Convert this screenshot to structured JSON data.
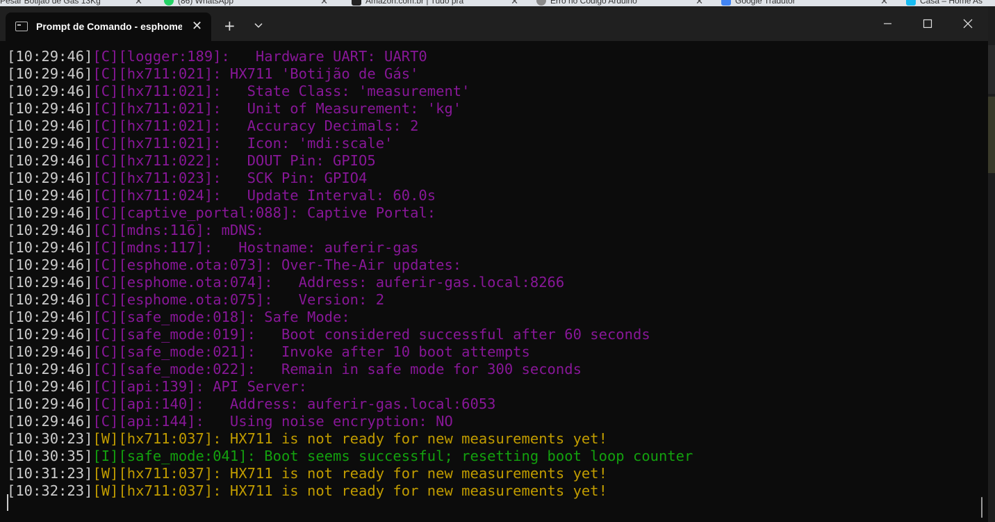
{
  "background_tabs": [
    {
      "label": "Pesar Botijão de Gás 13Kg",
      "favicon_color": "#cfd4da"
    },
    {
      "label": "(86) WhatsApp",
      "favicon_color": "#25d366"
    },
    {
      "label": "Amazon.com.br | Tudo pra",
      "favicon_color": "#222222"
    },
    {
      "label": "Erro no Código Arduino",
      "favicon_color": "#8a8a8a"
    },
    {
      "label": "Google Tradutor",
      "favicon_color": "#4285f4"
    },
    {
      "label": "Casa – Home As",
      "favicon_color": "#18bcf2"
    }
  ],
  "window": {
    "tab_title": "Prompt de Comando - esphome",
    "new_tab": "+",
    "close_glyph": "✕"
  },
  "colors": {
    "config": "#881798",
    "warning": "#c19c00",
    "info": "#13a10e",
    "timestamp": "#cccccc"
  },
  "log_lines": [
    {
      "ts": "[10:29:46]",
      "level": "c",
      "text": "[C][logger:189]:   Hardware UART: UART0"
    },
    {
      "ts": "[10:29:46]",
      "level": "c",
      "text": "[C][hx711:021]: HX711 'Botijão de Gás'"
    },
    {
      "ts": "[10:29:46]",
      "level": "c",
      "text": "[C][hx711:021]:   State Class: 'measurement'"
    },
    {
      "ts": "[10:29:46]",
      "level": "c",
      "text": "[C][hx711:021]:   Unit of Measurement: 'kg'"
    },
    {
      "ts": "[10:29:46]",
      "level": "c",
      "text": "[C][hx711:021]:   Accuracy Decimals: 2"
    },
    {
      "ts": "[10:29:46]",
      "level": "c",
      "text": "[C][hx711:021]:   Icon: 'mdi:scale'"
    },
    {
      "ts": "[10:29:46]",
      "level": "c",
      "text": "[C][hx711:022]:   DOUT Pin: GPIO5"
    },
    {
      "ts": "[10:29:46]",
      "level": "c",
      "text": "[C][hx711:023]:   SCK Pin: GPIO4"
    },
    {
      "ts": "[10:29:46]",
      "level": "c",
      "text": "[C][hx711:024]:   Update Interval: 60.0s"
    },
    {
      "ts": "[10:29:46]",
      "level": "c",
      "text": "[C][captive_portal:088]: Captive Portal:"
    },
    {
      "ts": "[10:29:46]",
      "level": "c",
      "text": "[C][mdns:116]: mDNS:"
    },
    {
      "ts": "[10:29:46]",
      "level": "c",
      "text": "[C][mdns:117]:   Hostname: auferir-gas"
    },
    {
      "ts": "[10:29:46]",
      "level": "c",
      "text": "[C][esphome.ota:073]: Over-The-Air updates:"
    },
    {
      "ts": "[10:29:46]",
      "level": "c",
      "text": "[C][esphome.ota:074]:   Address: auferir-gas.local:8266"
    },
    {
      "ts": "[10:29:46]",
      "level": "c",
      "text": "[C][esphome.ota:075]:   Version: 2"
    },
    {
      "ts": "[10:29:46]",
      "level": "c",
      "text": "[C][safe_mode:018]: Safe Mode:"
    },
    {
      "ts": "[10:29:46]",
      "level": "c",
      "text": "[C][safe_mode:019]:   Boot considered successful after 60 seconds"
    },
    {
      "ts": "[10:29:46]",
      "level": "c",
      "text": "[C][safe_mode:021]:   Invoke after 10 boot attempts"
    },
    {
      "ts": "[10:29:46]",
      "level": "c",
      "text": "[C][safe_mode:022]:   Remain in safe mode for 300 seconds"
    },
    {
      "ts": "[10:29:46]",
      "level": "c",
      "text": "[C][api:139]: API Server:"
    },
    {
      "ts": "[10:29:46]",
      "level": "c",
      "text": "[C][api:140]:   Address: auferir-gas.local:6053"
    },
    {
      "ts": "[10:29:46]",
      "level": "c",
      "text": "[C][api:144]:   Using noise encryption: NO"
    },
    {
      "ts": "[10:30:23]",
      "level": "w",
      "text": "[W][hx711:037]: HX711 is not ready for new measurements yet!"
    },
    {
      "ts": "[10:30:35]",
      "level": "i",
      "text": "[I][safe_mode:041]: Boot seems successful; resetting boot loop counter"
    },
    {
      "ts": "[10:31:23]",
      "level": "w",
      "text": "[W][hx711:037]: HX711 is not ready for new measurements yet!"
    },
    {
      "ts": "[10:32:23]",
      "level": "w",
      "text": "[W][hx711:037]: HX711 is not ready for new measurements yet!"
    }
  ]
}
